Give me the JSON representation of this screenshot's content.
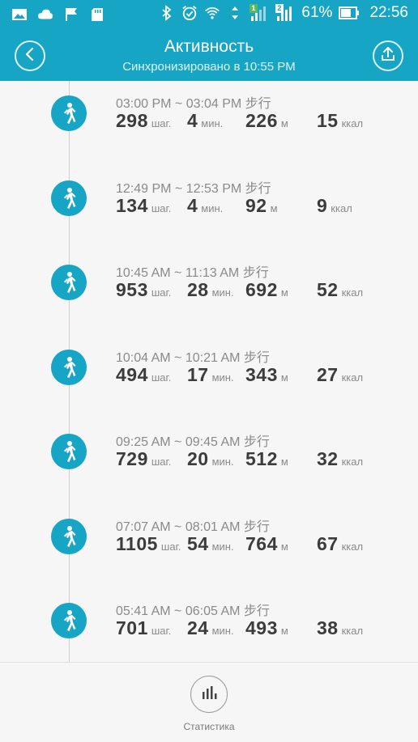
{
  "status_bar": {
    "battery": "61%",
    "time": "22:56",
    "sim1": "1",
    "sim2": "2"
  },
  "header": {
    "title": "Активность",
    "subtitle": "Синхронизировано в 10:55 PM"
  },
  "units": {
    "steps": "шаг.",
    "minutes": "мин.",
    "meters": "м",
    "kcal": "ккал"
  },
  "entries": [
    {
      "time": "03:00 PM ~ 03:04 PM 步行",
      "steps": "298",
      "minutes": "4",
      "meters": "226",
      "kcal": "15"
    },
    {
      "time": "12:49 PM ~ 12:53 PM 步行",
      "steps": "134",
      "minutes": "4",
      "meters": "92",
      "kcal": "9"
    },
    {
      "time": "10:45 AM ~ 11:13 AM 步行",
      "steps": "953",
      "minutes": "28",
      "meters": "692",
      "kcal": "52"
    },
    {
      "time": "10:04 AM ~ 10:21 AM 步行",
      "steps": "494",
      "minutes": "17",
      "meters": "343",
      "kcal": "27"
    },
    {
      "time": "09:25 AM ~ 09:45 AM 步行",
      "steps": "729",
      "minutes": "20",
      "meters": "512",
      "kcal": "32"
    },
    {
      "time": "07:07 AM ~ 08:01 AM 步行",
      "steps": "1105",
      "minutes": "54",
      "meters": "764",
      "kcal": "67"
    },
    {
      "time": "05:41 AM ~ 06:05 AM 步行",
      "steps": "701",
      "minutes": "24",
      "meters": "493",
      "kcal": "38"
    }
  ],
  "bottom": {
    "statistics_label": "Статистика"
  },
  "colors": {
    "accent": "#17a5c5",
    "background": "#f6f6f6"
  }
}
